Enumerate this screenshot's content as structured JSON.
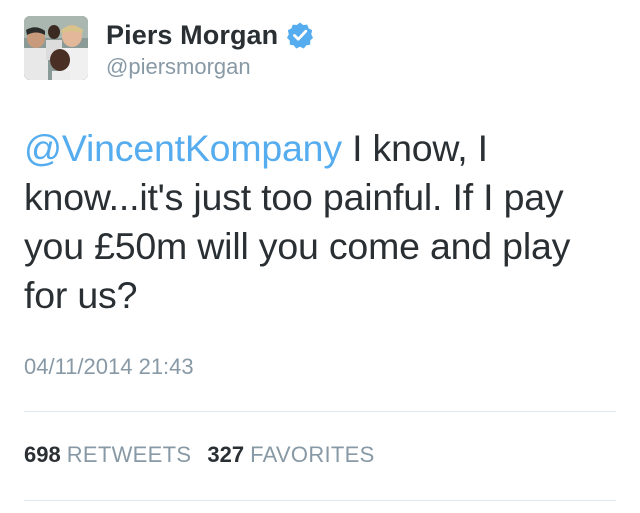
{
  "user": {
    "display_name": "Piers Morgan",
    "handle": "@piersmorgan",
    "verified": true,
    "avatar_icon": "group-photo-avatar"
  },
  "tweet": {
    "mention": "@VincentKompany",
    "text": " I know, I know...it's just too painful. If I pay you £50m will you come and play for us?",
    "timestamp": "04/11/2014 21:43"
  },
  "stats": {
    "retweets_count": "698",
    "retweets_label": "RETWEETS",
    "favorites_count": "327",
    "favorites_label": "FAVORITES"
  },
  "colors": {
    "link": "#55acee",
    "text": "#292f33",
    "muted": "#8899a6",
    "divider": "#e1e8ed",
    "verified_badge": "#55acee"
  }
}
